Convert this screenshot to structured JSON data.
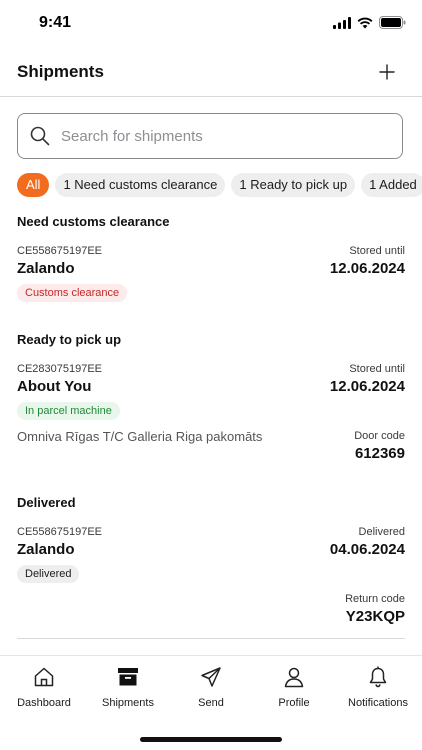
{
  "status_bar": {
    "time": "9:41"
  },
  "header": {
    "title": "Shipments",
    "add_icon": "plus-icon"
  },
  "search": {
    "placeholder": "Search for shipments",
    "value": ""
  },
  "filters": [
    {
      "label": "All",
      "active": true
    },
    {
      "label": "1 Need customs clearance",
      "active": false
    },
    {
      "label": "1 Ready to pick up",
      "active": false
    },
    {
      "label": "1 Added",
      "active": false
    }
  ],
  "sections": {
    "customs": {
      "title": "Need customs clearance",
      "item": {
        "tracking": "CE558675197EE",
        "shop": "Zalando",
        "status": "Customs clearance",
        "right_label": "Stored until",
        "right_value": "12.06.2024"
      }
    },
    "pickup": {
      "title": "Ready to pick up",
      "item": {
        "tracking": "CE283075197EE",
        "shop": "About You",
        "status": "In parcel machine",
        "right_label": "Stored until",
        "right_value": "12.06.2024",
        "location": "Omniva Rīgas T/C Galleria Riga pakomāts",
        "code_label": "Door code",
        "code_value": "612369"
      }
    },
    "delivered": {
      "title": "Delivered",
      "item": {
        "tracking": "CE558675197EE",
        "shop": "Zalando",
        "status": "Delivered",
        "right_label": "Delivered",
        "right_value": "04.06.2024",
        "code_label": "Return code",
        "code_value": "Y23KQP"
      }
    }
  },
  "tabs": [
    {
      "label": "Dashboard",
      "icon": "home-icon"
    },
    {
      "label": "Shipments",
      "icon": "box-icon"
    },
    {
      "label": "Send",
      "icon": "send-icon"
    },
    {
      "label": "Profile",
      "icon": "profile-icon"
    },
    {
      "label": "Notifications",
      "icon": "bell-icon"
    }
  ],
  "colors": {
    "accent": "#f26c1e",
    "customs_badge_bg": "#fdeaea",
    "customs_badge_text": "#c62828",
    "machine_badge_bg": "#e9f6ec",
    "machine_badge_text": "#1f8a3a"
  }
}
